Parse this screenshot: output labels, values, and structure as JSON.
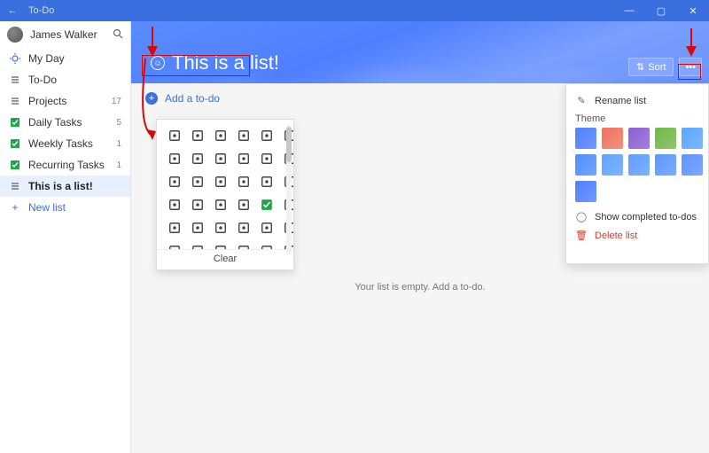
{
  "titlebar": {
    "app_name": "To-Do"
  },
  "profile": {
    "name": "James Walker"
  },
  "sidebar": {
    "items": [
      {
        "icon": "sun",
        "label": "My Day",
        "count": "",
        "active": false,
        "cls": "myday"
      },
      {
        "icon": "list",
        "label": "To-Do",
        "count": "",
        "active": false,
        "cls": ""
      },
      {
        "icon": "list",
        "label": "Projects",
        "count": "17",
        "active": false,
        "cls": ""
      },
      {
        "icon": "check",
        "label": "Daily Tasks",
        "count": "5",
        "active": false,
        "cls": "checkbox"
      },
      {
        "icon": "check",
        "label": "Weekly Tasks",
        "count": "1",
        "active": false,
        "cls": "checkbox"
      },
      {
        "icon": "check",
        "label": "Recurring Tasks",
        "count": "1",
        "active": false,
        "cls": "checkbox"
      },
      {
        "icon": "list",
        "label": "This is a list!",
        "count": "",
        "active": true,
        "cls": ""
      }
    ],
    "new_list_label": "New list"
  },
  "hero": {
    "title": "This is a list!",
    "sort_label": "Sort"
  },
  "add_row": {
    "placeholder": "Add a to-do"
  },
  "empty_message": "Your list is empty. Add a to-do.",
  "icon_picker": {
    "clear_label": "Clear",
    "icons": [
      "trash",
      "clipboard",
      "cloud",
      "hanger",
      "pencil",
      "phone",
      "camera",
      "handset",
      "cup",
      "house",
      "leaf",
      "paper",
      "briefcase",
      "backpack",
      "pot",
      "plane",
      "book",
      "tag",
      "cabinet",
      "purse",
      "coffee",
      "box",
      "check",
      "bank",
      "diary",
      "monitor",
      "calendar",
      "music",
      "bookmark",
      "bin",
      "safe",
      "sheet",
      "window",
      "clock",
      "flag",
      "disk"
    ]
  },
  "ctx_menu": {
    "rename": "Rename list",
    "theme_label": "Theme",
    "swatches": [
      "#4f7fff",
      "#f0735e",
      "#8b5fd6",
      "#6fb948",
      "#5aa6ff",
      "#4f8fff",
      "#5fa3ff",
      "#5f9dff",
      "#5c97ff",
      "#5f93ff",
      "#4f7fff"
    ],
    "show_completed": "Show completed to-dos",
    "delete": "Delete list"
  }
}
